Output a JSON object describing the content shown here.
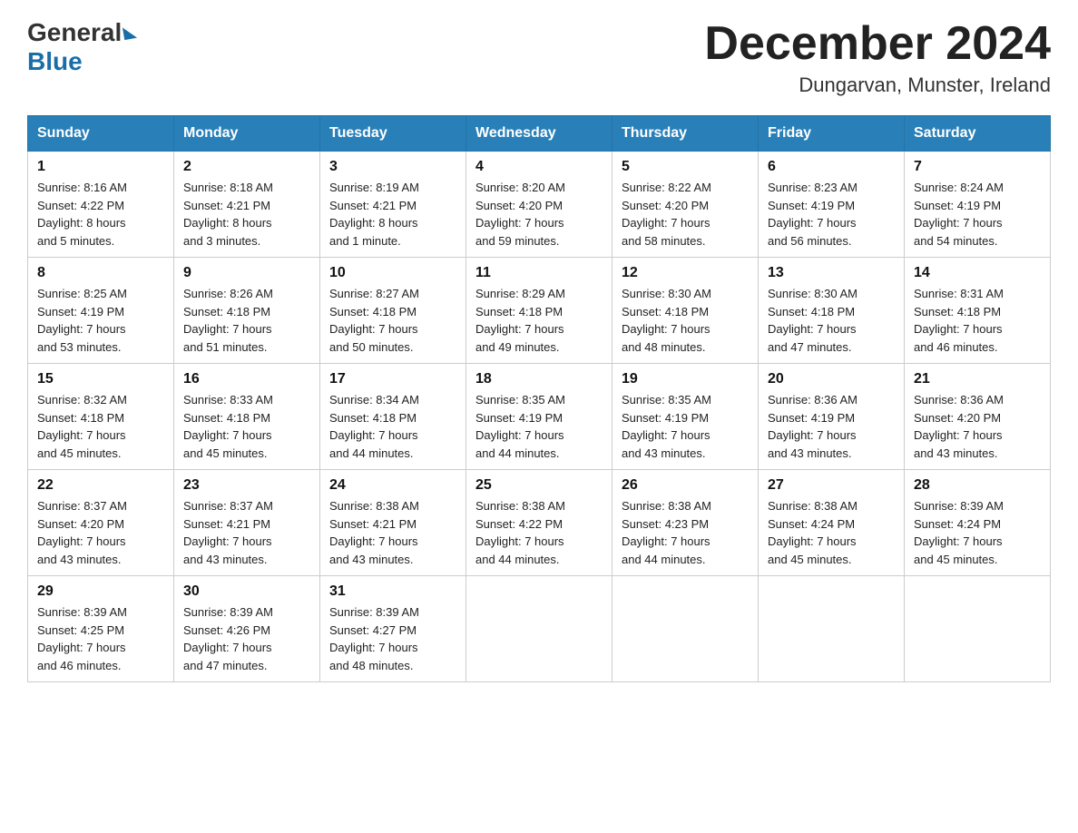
{
  "header": {
    "logo": {
      "text1": "General",
      "text2": "Blue"
    },
    "title": "December 2024",
    "location": "Dungarvan, Munster, Ireland"
  },
  "days_of_week": [
    "Sunday",
    "Monday",
    "Tuesday",
    "Wednesday",
    "Thursday",
    "Friday",
    "Saturday"
  ],
  "weeks": [
    [
      {
        "day": "1",
        "info": "Sunrise: 8:16 AM\nSunset: 4:22 PM\nDaylight: 8 hours\nand 5 minutes."
      },
      {
        "day": "2",
        "info": "Sunrise: 8:18 AM\nSunset: 4:21 PM\nDaylight: 8 hours\nand 3 minutes."
      },
      {
        "day": "3",
        "info": "Sunrise: 8:19 AM\nSunset: 4:21 PM\nDaylight: 8 hours\nand 1 minute."
      },
      {
        "day": "4",
        "info": "Sunrise: 8:20 AM\nSunset: 4:20 PM\nDaylight: 7 hours\nand 59 minutes."
      },
      {
        "day": "5",
        "info": "Sunrise: 8:22 AM\nSunset: 4:20 PM\nDaylight: 7 hours\nand 58 minutes."
      },
      {
        "day": "6",
        "info": "Sunrise: 8:23 AM\nSunset: 4:19 PM\nDaylight: 7 hours\nand 56 minutes."
      },
      {
        "day": "7",
        "info": "Sunrise: 8:24 AM\nSunset: 4:19 PM\nDaylight: 7 hours\nand 54 minutes."
      }
    ],
    [
      {
        "day": "8",
        "info": "Sunrise: 8:25 AM\nSunset: 4:19 PM\nDaylight: 7 hours\nand 53 minutes."
      },
      {
        "day": "9",
        "info": "Sunrise: 8:26 AM\nSunset: 4:18 PM\nDaylight: 7 hours\nand 51 minutes."
      },
      {
        "day": "10",
        "info": "Sunrise: 8:27 AM\nSunset: 4:18 PM\nDaylight: 7 hours\nand 50 minutes."
      },
      {
        "day": "11",
        "info": "Sunrise: 8:29 AM\nSunset: 4:18 PM\nDaylight: 7 hours\nand 49 minutes."
      },
      {
        "day": "12",
        "info": "Sunrise: 8:30 AM\nSunset: 4:18 PM\nDaylight: 7 hours\nand 48 minutes."
      },
      {
        "day": "13",
        "info": "Sunrise: 8:30 AM\nSunset: 4:18 PM\nDaylight: 7 hours\nand 47 minutes."
      },
      {
        "day": "14",
        "info": "Sunrise: 8:31 AM\nSunset: 4:18 PM\nDaylight: 7 hours\nand 46 minutes."
      }
    ],
    [
      {
        "day": "15",
        "info": "Sunrise: 8:32 AM\nSunset: 4:18 PM\nDaylight: 7 hours\nand 45 minutes."
      },
      {
        "day": "16",
        "info": "Sunrise: 8:33 AM\nSunset: 4:18 PM\nDaylight: 7 hours\nand 45 minutes."
      },
      {
        "day": "17",
        "info": "Sunrise: 8:34 AM\nSunset: 4:18 PM\nDaylight: 7 hours\nand 44 minutes."
      },
      {
        "day": "18",
        "info": "Sunrise: 8:35 AM\nSunset: 4:19 PM\nDaylight: 7 hours\nand 44 minutes."
      },
      {
        "day": "19",
        "info": "Sunrise: 8:35 AM\nSunset: 4:19 PM\nDaylight: 7 hours\nand 43 minutes."
      },
      {
        "day": "20",
        "info": "Sunrise: 8:36 AM\nSunset: 4:19 PM\nDaylight: 7 hours\nand 43 minutes."
      },
      {
        "day": "21",
        "info": "Sunrise: 8:36 AM\nSunset: 4:20 PM\nDaylight: 7 hours\nand 43 minutes."
      }
    ],
    [
      {
        "day": "22",
        "info": "Sunrise: 8:37 AM\nSunset: 4:20 PM\nDaylight: 7 hours\nand 43 minutes."
      },
      {
        "day": "23",
        "info": "Sunrise: 8:37 AM\nSunset: 4:21 PM\nDaylight: 7 hours\nand 43 minutes."
      },
      {
        "day": "24",
        "info": "Sunrise: 8:38 AM\nSunset: 4:21 PM\nDaylight: 7 hours\nand 43 minutes."
      },
      {
        "day": "25",
        "info": "Sunrise: 8:38 AM\nSunset: 4:22 PM\nDaylight: 7 hours\nand 44 minutes."
      },
      {
        "day": "26",
        "info": "Sunrise: 8:38 AM\nSunset: 4:23 PM\nDaylight: 7 hours\nand 44 minutes."
      },
      {
        "day": "27",
        "info": "Sunrise: 8:38 AM\nSunset: 4:24 PM\nDaylight: 7 hours\nand 45 minutes."
      },
      {
        "day": "28",
        "info": "Sunrise: 8:39 AM\nSunset: 4:24 PM\nDaylight: 7 hours\nand 45 minutes."
      }
    ],
    [
      {
        "day": "29",
        "info": "Sunrise: 8:39 AM\nSunset: 4:25 PM\nDaylight: 7 hours\nand 46 minutes."
      },
      {
        "day": "30",
        "info": "Sunrise: 8:39 AM\nSunset: 4:26 PM\nDaylight: 7 hours\nand 47 minutes."
      },
      {
        "day": "31",
        "info": "Sunrise: 8:39 AM\nSunset: 4:27 PM\nDaylight: 7 hours\nand 48 minutes."
      },
      {
        "day": "",
        "info": ""
      },
      {
        "day": "",
        "info": ""
      },
      {
        "day": "",
        "info": ""
      },
      {
        "day": "",
        "info": ""
      }
    ]
  ]
}
